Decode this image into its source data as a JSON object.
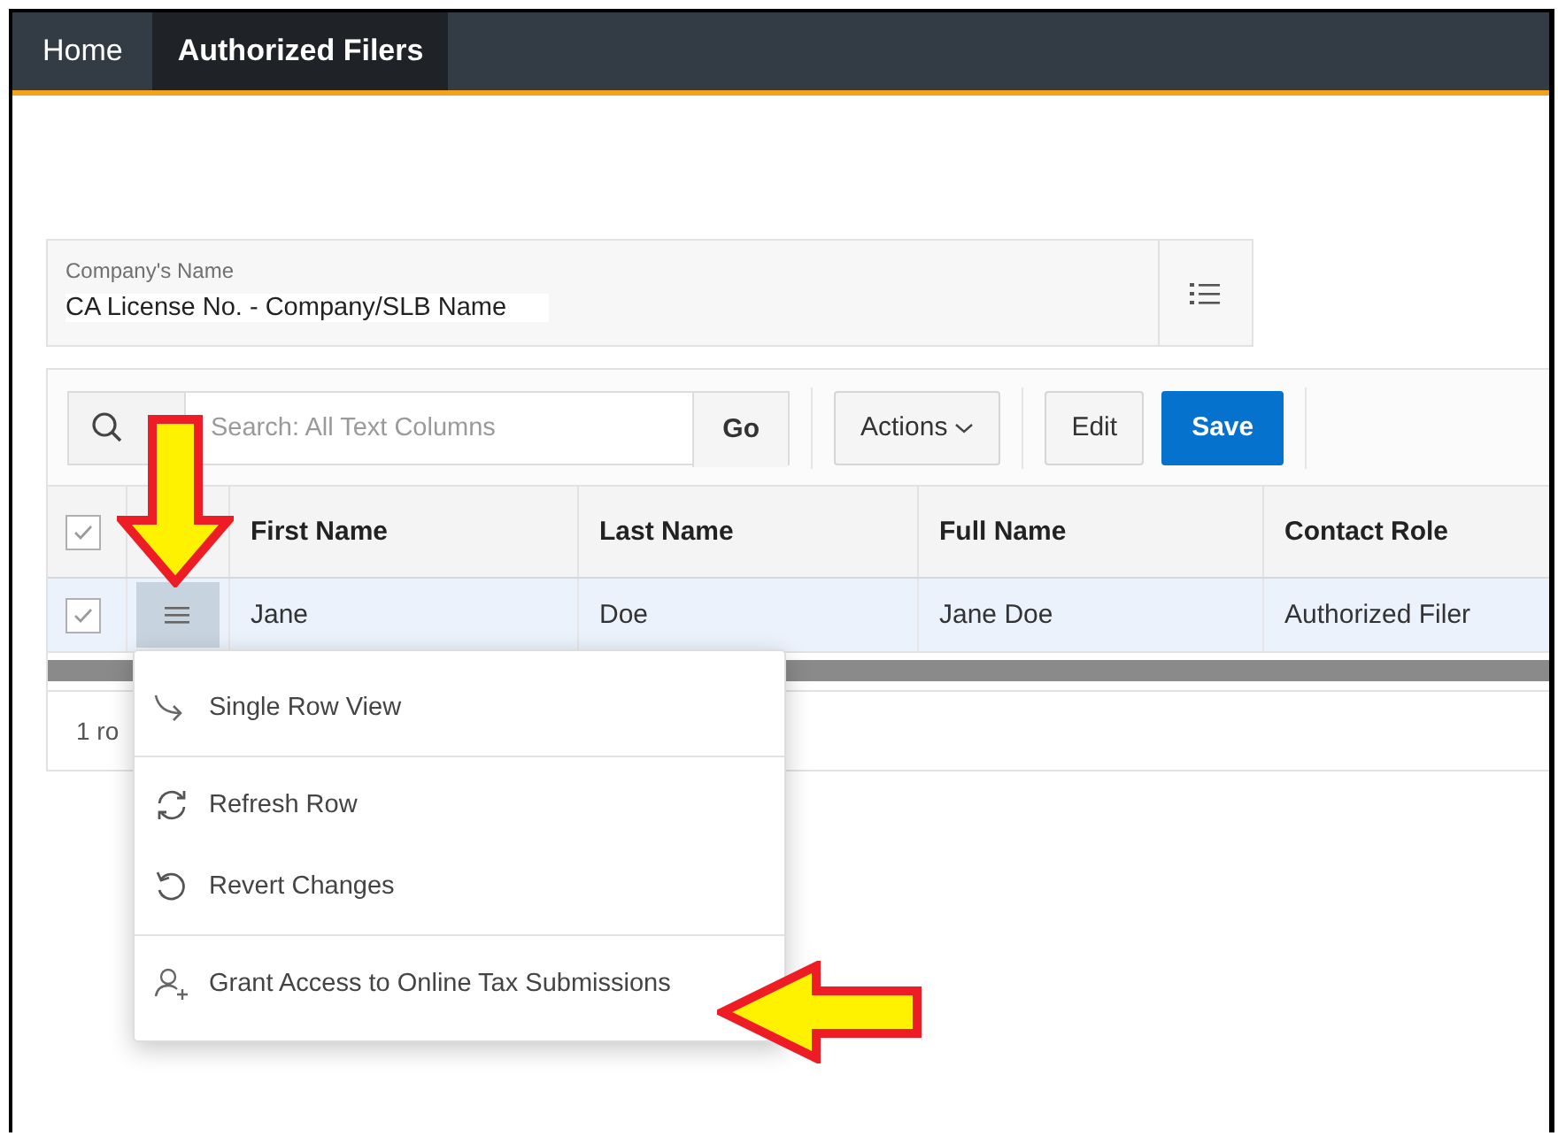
{
  "nav": {
    "tabs": [
      {
        "label": "Home",
        "selected": false
      },
      {
        "label": "Authorized Filers",
        "selected": true
      }
    ]
  },
  "company_field": {
    "label": "Company's Name",
    "value": "CA License No. - Company/SLB Name"
  },
  "toolbar": {
    "search": {
      "placeholder": "Search: All Text Columns",
      "go_label": "Go"
    },
    "buttons": [
      {
        "label": "Actions",
        "kind": "menu"
      },
      {
        "label": "Edit",
        "kind": "default"
      },
      {
        "label": "Save",
        "kind": "primary"
      }
    ]
  },
  "grid": {
    "select_all_checked": true,
    "columns": [
      "First Name",
      "Last Name",
      "Full Name",
      "Contact Role"
    ],
    "rows": [
      {
        "checked": true,
        "selected": true,
        "cells": [
          "Jane",
          "Doe",
          "Jane Doe",
          "Authorized Filer"
        ]
      }
    ],
    "footer": "1 ro"
  },
  "row_menu": {
    "groups": [
      [
        {
          "label": "Single Row View",
          "kind": "view"
        }
      ],
      [
        {
          "label": "Refresh Row",
          "kind": "refresh"
        },
        {
          "label": "Revert Changes",
          "kind": "revert"
        }
      ],
      [
        {
          "label": "Grant Access to Online Tax Submissions",
          "kind": "grant"
        }
      ]
    ]
  }
}
